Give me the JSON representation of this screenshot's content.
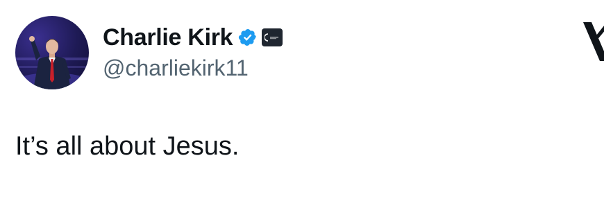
{
  "author": {
    "display_name": "Charlie Kirk",
    "handle": "@charliekirk11",
    "verified": true,
    "verified_badge_icon": "verified-badge-icon",
    "verified_color": "#1d9bf0",
    "affiliate_icon": "organization-affiliate-icon",
    "avatar_icon": "profile-avatar"
  },
  "platform": {
    "logo_icon": "x-logo-icon"
  },
  "tweet": {
    "text": "It’s all about Jesus."
  },
  "colors": {
    "text_primary": "#0f1419",
    "text_secondary": "#536471",
    "background": "#ffffff"
  }
}
